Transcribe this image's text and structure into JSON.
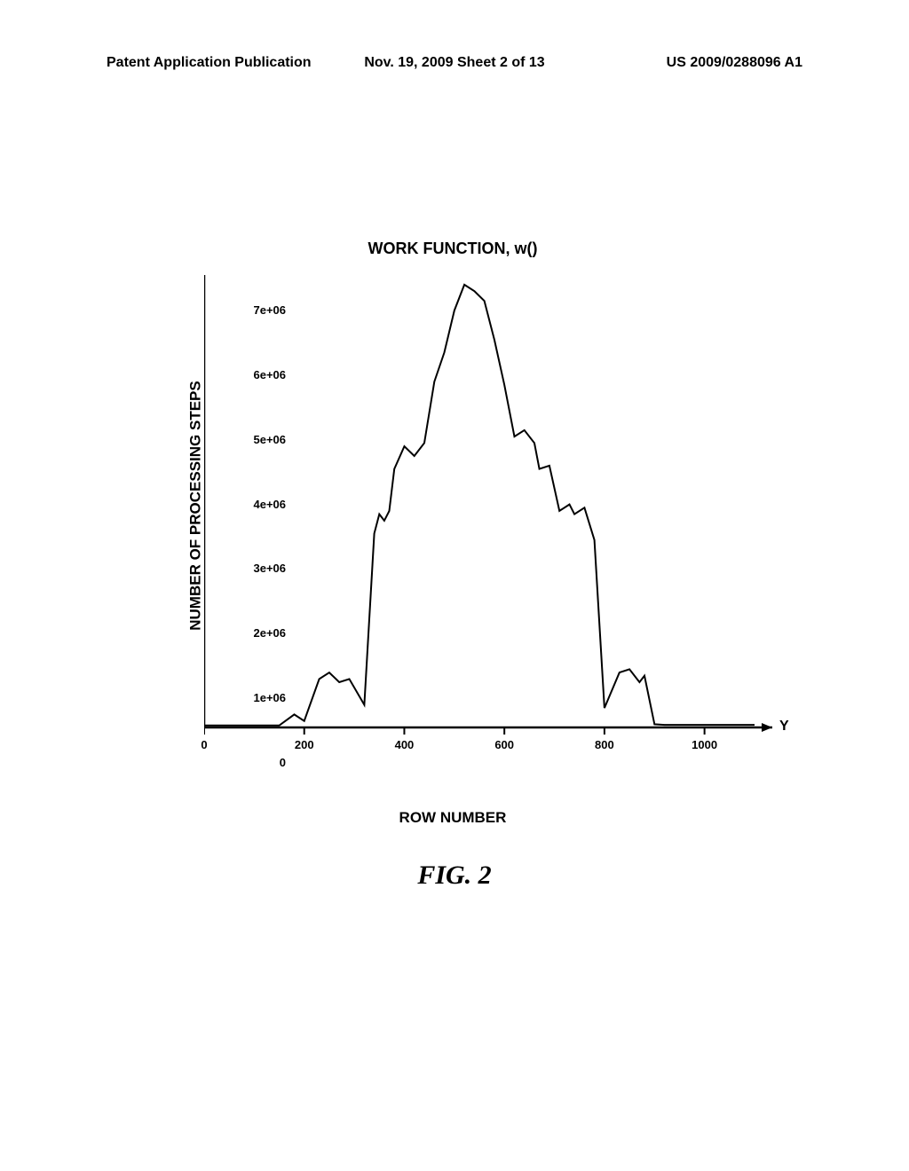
{
  "header": {
    "left": "Patent Application Publication",
    "center": "Nov. 19, 2009  Sheet 2 of 13",
    "right": "US 2009/0288096 A1"
  },
  "figure_label": "FIG.  2",
  "chart_data": {
    "type": "line",
    "title": "WORK FUNCTION, w()",
    "xlabel": "ROW NUMBER",
    "ylabel": "NUMBER OF PROCESSING STEPS",
    "xlim": [
      0,
      1100
    ],
    "ylim": [
      0,
      7000000
    ],
    "x_ticks": [
      0,
      200,
      400,
      600,
      800,
      1000
    ],
    "y_ticks": [
      0,
      1000000,
      2000000,
      3000000,
      4000000,
      5000000,
      6000000,
      7000000
    ],
    "y_tick_labels": [
      "0",
      "1e+06",
      "2e+06",
      "3e+06",
      "4e+06",
      "5e+06",
      "6e+06",
      "7e+06"
    ],
    "x_arrow_label": "Y",
    "series": [
      {
        "name": "work_function",
        "x": [
          0,
          150,
          180,
          200,
          230,
          250,
          270,
          290,
          320,
          340,
          350,
          360,
          370,
          380,
          400,
          420,
          440,
          460,
          480,
          500,
          520,
          540,
          560,
          580,
          600,
          620,
          640,
          660,
          670,
          690,
          710,
          730,
          740,
          760,
          780,
          800,
          830,
          850,
          870,
          880,
          900,
          920,
          1000,
          1100
        ],
        "y": [
          30000,
          30000,
          200000,
          100000,
          750000,
          850000,
          700000,
          750000,
          350000,
          3000000,
          3300000,
          3200000,
          3350000,
          4000000,
          4350000,
          4200000,
          4400000,
          5350000,
          5800000,
          6450000,
          6850000,
          6750000,
          6600000,
          6000000,
          5300000,
          4500000,
          4600000,
          4400000,
          4000000,
          4050000,
          3350000,
          3450000,
          3300000,
          3400000,
          2900000,
          300000,
          850000,
          900000,
          700000,
          800000,
          50000,
          40000,
          40000,
          40000
        ]
      }
    ]
  }
}
